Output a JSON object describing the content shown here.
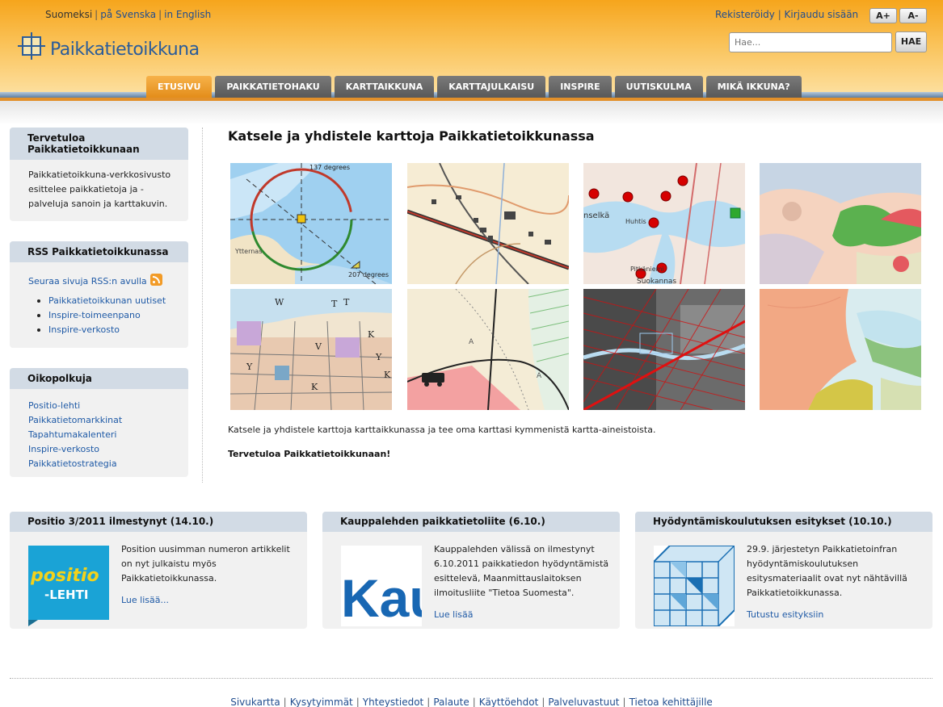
{
  "header": {
    "languages": {
      "current": "Suomeksi",
      "swedish": "på Svenska",
      "english": "in English",
      "separator": "|"
    },
    "logo_text": "Paikkatietoikkuna",
    "register": "Rekisteröidy",
    "login": "Kirjaudu sisään",
    "font_increase": "A+",
    "font_decrease": "A-",
    "search_placeholder": "Hae...",
    "search_button": "HAE"
  },
  "nav": {
    "tabs": [
      {
        "label": "ETUSIVU",
        "active": true
      },
      {
        "label": "PAIKKATIETOHAKU",
        "active": false
      },
      {
        "label": "KARTTAIKKUNA",
        "active": false
      },
      {
        "label": "KARTTAJULKAISU",
        "active": false
      },
      {
        "label": "INSPIRE",
        "active": false
      },
      {
        "label": "UUTISKULMA",
        "active": false
      },
      {
        "label": "MIKÄ IKKUNA?",
        "active": false
      }
    ]
  },
  "sidebar": {
    "welcome": {
      "title": "Tervetuloa Paikkatietoikkunaan",
      "text": "Paikkatietoikkuna-verkkosivusto esittelee paikkatietoja ja -palveluja sanoin ja karttakuvin."
    },
    "rss": {
      "title": "RSS Paikkatietoikkunassa",
      "follow": "Seuraa sivuja RSS:n avulla",
      "items": [
        "Paikkatietoikkunan uutiset",
        "Inspire-toimeenpano",
        "Inspire-verkosto"
      ]
    },
    "shortcuts": {
      "title": "Oikopolkuja",
      "items": [
        "Positio-lehti",
        "Paikkatietomarkkinat",
        "Tapahtumakalenteri",
        "Inspire-verkosto",
        "Paikkatietostrategia"
      ]
    }
  },
  "main": {
    "title": "Katsele ja yhdistele karttoja Paikkatietoikkunassa",
    "map_labels": {
      "deg1": "137 degrees",
      "deg2": "207 degrees",
      "place1": "Ytternas",
      "place2": "Huhtis",
      "place3": "Pitkäniemi",
      "place4": "Suokannas",
      "place5": "nselkä"
    },
    "description": "Katsele ja yhdistele karttoja karttaikkunassa ja tee oma karttasi kymmenistä kartta-aineistoista.",
    "welcome": "Tervetuloa Paikkatietoikkunaan!"
  },
  "news": [
    {
      "title": "Positio 3/2011 ilmestynyt (14.10.)",
      "text": "Position uusimman numeron artikkelit on nyt julkaistu myös Paikkatietoikkunassa.",
      "link": "Lue lisää...",
      "img_text1": "positio",
      "img_text2": "-LEHTI"
    },
    {
      "title": "Kauppalehden paikkatietoliite (6.10.)",
      "text": "Kauppalehden välissä on ilmestynyt 6.10.2011 paikkatiedon hyödyntämistä esittelevä, Maanmittauslaitoksen ilmoitusliite \"Tietoa Suomesta\".",
      "link": "Lue lisää",
      "img_text1": "Kau"
    },
    {
      "title": "Hyödyntämiskoulutuksen esitykset (10.10.)",
      "text": "29.9. järjestetyn Paikkatietoinfran hyödyntämiskoulutuksen esitysmateriaalit ovat nyt nähtävillä Paikkatietoikkunassa.",
      "link": "Tutustu esityksiin"
    }
  ],
  "footer": {
    "links": [
      "Sivukartta",
      "Kysytyimmät",
      "Yhteystiedot",
      "Palaute",
      "Käyttöehdot",
      "Palveluvastuut",
      "Tietoa kehittäjille"
    ]
  },
  "colors": {
    "accent": "#f6a51c",
    "nav_tab": "#666666",
    "nav_active": "#e8951e",
    "box_header": "#d2dbe5",
    "link": "#1f5aa6"
  }
}
